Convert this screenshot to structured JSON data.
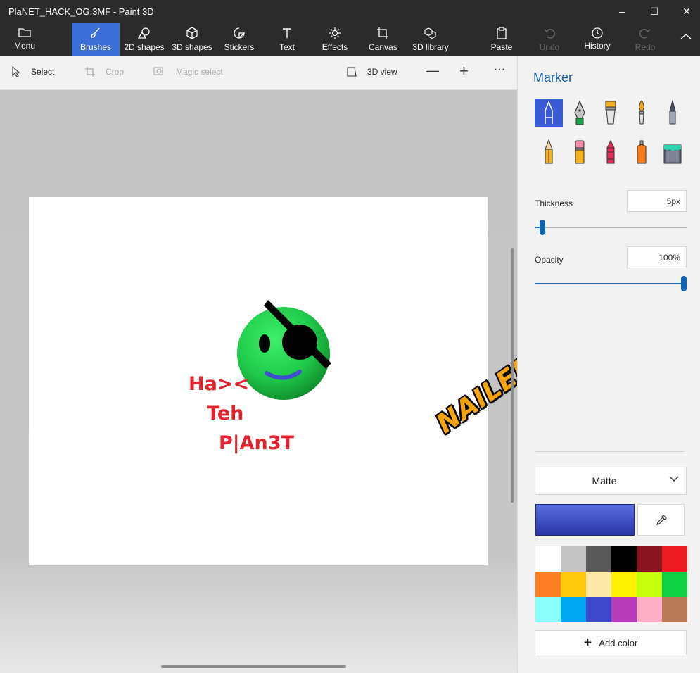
{
  "window": {
    "title": "PlaNET_HACK_OG.3MF - Paint 3D"
  },
  "ribbon": {
    "menu": "Menu",
    "brushes": "Brushes",
    "shapes2d": "2D shapes",
    "shapes3d": "3D shapes",
    "stickers": "Stickers",
    "text": "Text",
    "effects": "Effects",
    "canvas": "Canvas",
    "library": "3D library",
    "paste": "Paste",
    "undo": "Undo",
    "history": "History",
    "redo": "Redo"
  },
  "toolbar": {
    "select": "Select",
    "crop": "Crop",
    "magic_select": "Magic select",
    "view3d": "3D view",
    "zoom_out": "—",
    "zoom_in": "+",
    "more": "···"
  },
  "canvas": {
    "line1": "Ha><",
    "line2": "Teh",
    "line3": "P|An3T",
    "sticker_text": "NAILED IT!!"
  },
  "panel": {
    "title": "Marker",
    "brushes": [
      "marker-icon",
      "calligraphy-pen-icon",
      "oil-brush-icon",
      "watercolor-icon",
      "pixel-pen-icon",
      "pencil-icon",
      "eraser-icon",
      "crayon-icon",
      "spray-can-icon",
      "fill-icon"
    ],
    "thickness_label": "Thickness",
    "thickness_value": "5px",
    "thickness_fraction": 0.05,
    "opacity_label": "Opacity",
    "opacity_value": "100%",
    "opacity_fraction": 1.0,
    "finish": "Matte",
    "add_color": "Add color",
    "palette": [
      "#ffffff",
      "#c3c3c3",
      "#585858",
      "#000000",
      "#88141f",
      "#ed1c24",
      "#ff7f27",
      "#ffc90e",
      "#fde8a8",
      "#fff200",
      "#c4ff0e",
      "#0ed145",
      "#8cfffb",
      "#00a8f3",
      "#3f48cc",
      "#b83dba",
      "#ffaec8",
      "#b97a57"
    ]
  },
  "colors": {
    "accent": "#3d6fd8",
    "panel_title": "#1a5fa8",
    "text_red": "#e2232d"
  }
}
